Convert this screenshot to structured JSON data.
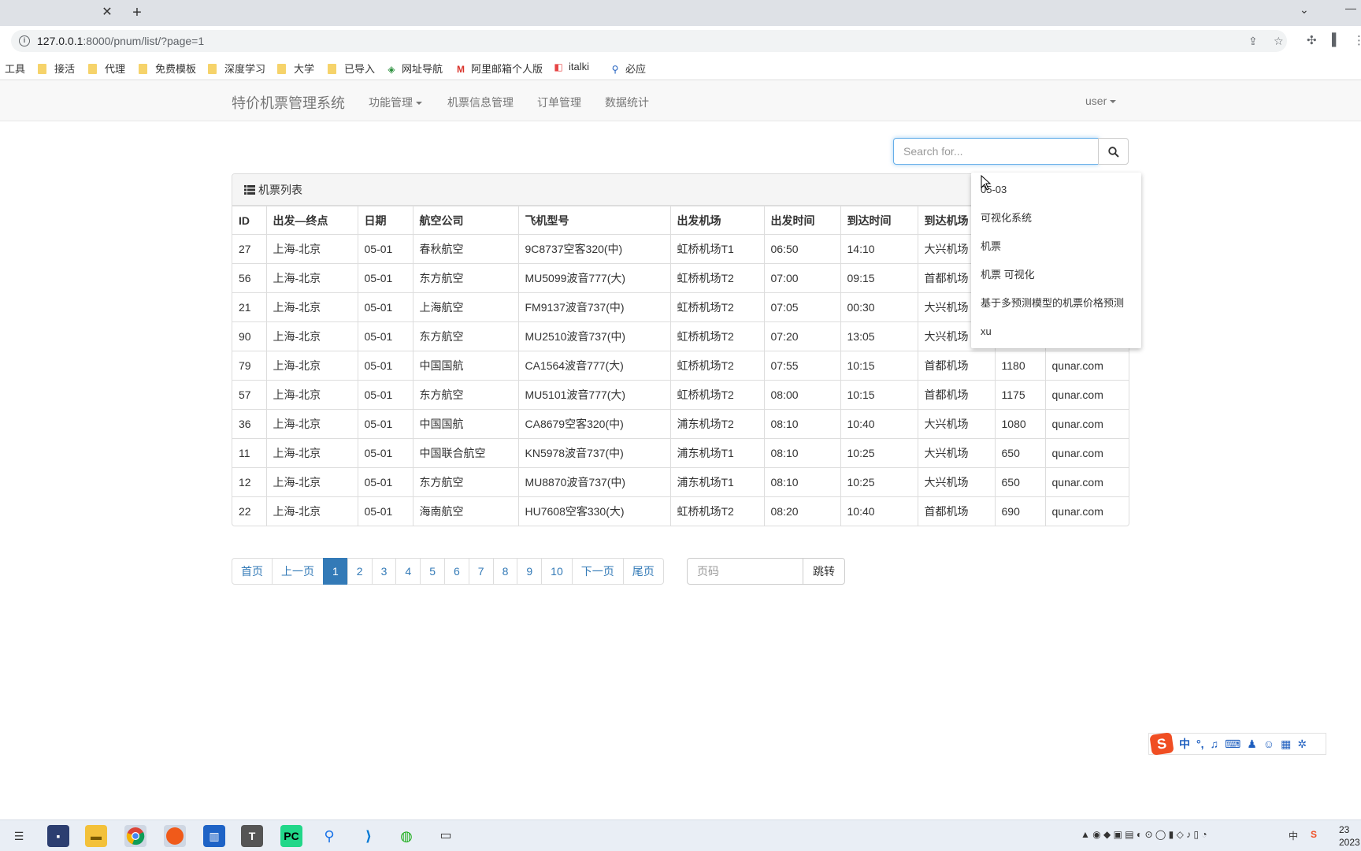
{
  "browser": {
    "url_host": "127.0.0.1",
    "url_path": ":8000/pnum/list/?page=1",
    "bookmarks": [
      "工具",
      "接活",
      "代理",
      "免费模板",
      "深度学习",
      "大学",
      "已导入",
      "网址导航",
      "阿里邮箱个人版",
      "italki",
      "必应"
    ]
  },
  "navbar": {
    "brand": "特价机票管理系统",
    "items": [
      "功能管理",
      "机票信息管理",
      "订单管理",
      "数据统计"
    ],
    "user": "user"
  },
  "search": {
    "placeholder": "Search for..."
  },
  "panel": {
    "title": "机票列表"
  },
  "table": {
    "headers": [
      "ID",
      "出发—终点",
      "日期",
      "航空公司",
      "飞机型号",
      "出发机场",
      "出发时间",
      "到达时间",
      "到达机场",
      "",
      ""
    ],
    "rows": [
      [
        "27",
        "上海-北京",
        "05-01",
        "春秋航空",
        "9C8737空客320(中)",
        "虹桥机场T1",
        "06:50",
        "14:10",
        "大兴机场",
        "",
        ""
      ],
      [
        "56",
        "上海-北京",
        "05-01",
        "东方航空",
        "MU5099波音777(大)",
        "虹桥机场T2",
        "07:00",
        "09:15",
        "首都机场",
        "",
        ""
      ],
      [
        "21",
        "上海-北京",
        "05-01",
        "上海航空",
        "FM9137波音737(中)",
        "虹桥机场T2",
        "07:05",
        "00:30",
        "大兴机场",
        "",
        ""
      ],
      [
        "90",
        "上海-北京",
        "05-01",
        "东方航空",
        "MU2510波音737(中)",
        "虹桥机场T2",
        "07:20",
        "13:05",
        "大兴机场",
        "",
        ""
      ],
      [
        "79",
        "上海-北京",
        "05-01",
        "中国国航",
        "CA1564波音777(大)",
        "虹桥机场T2",
        "07:55",
        "10:15",
        "首都机场",
        "1180",
        "qunar.com"
      ],
      [
        "57",
        "上海-北京",
        "05-01",
        "东方航空",
        "MU5101波音777(大)",
        "虹桥机场T2",
        "08:00",
        "10:15",
        "首都机场",
        "1175",
        "qunar.com"
      ],
      [
        "36",
        "上海-北京",
        "05-01",
        "中国国航",
        "CA8679空客320(中)",
        "浦东机场T2",
        "08:10",
        "10:40",
        "大兴机场",
        "1080",
        "qunar.com"
      ],
      [
        "11",
        "上海-北京",
        "05-01",
        "中国联合航空",
        "KN5978波音737(中)",
        "浦东机场T1",
        "08:10",
        "10:25",
        "大兴机场",
        "650",
        "qunar.com"
      ],
      [
        "12",
        "上海-北京",
        "05-01",
        "东方航空",
        "MU8870波音737(中)",
        "浦东机场T1",
        "08:10",
        "10:25",
        "大兴机场",
        "650",
        "qunar.com"
      ],
      [
        "22",
        "上海-北京",
        "05-01",
        "海南航空",
        "HU7608空客330(大)",
        "虹桥机场T2",
        "08:20",
        "10:40",
        "首都机场",
        "690",
        "qunar.com"
      ]
    ]
  },
  "autocomplete": [
    "05-03",
    "可视化系统",
    "机票",
    "机票 可视化",
    "基于多预测模型的机票价格预测",
    "xu"
  ],
  "pagination": {
    "items": [
      "首页",
      "上一页",
      "1",
      "2",
      "3",
      "4",
      "5",
      "6",
      "7",
      "8",
      "9",
      "10",
      "下一页",
      "尾页"
    ],
    "active": "1",
    "jump_placeholder": "页码",
    "jump_label": "跳转"
  },
  "ime": {
    "mode": "中"
  },
  "taskbar": {
    "tray_lang": "中",
    "clock_line1": "23",
    "clock_line2": "2023"
  },
  "colors": {
    "primary": "#337ab7",
    "navbar_bg": "#f8f8f8",
    "focus_border": "#66afe9"
  }
}
